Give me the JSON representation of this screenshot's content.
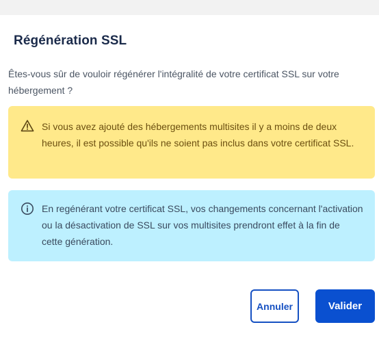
{
  "dialog": {
    "title": "Régénération SSL",
    "question": "Êtes-vous sûr de vouloir régénérer l'intégralité de votre certificat SSL sur votre hébergement ?"
  },
  "alerts": [
    {
      "type": "warning",
      "icon": "warning-triangle-icon",
      "text": "Si vous avez ajouté des hébergements multisites il y a moins de deux heures, il est possible qu'ils ne soient pas inclus dans votre certificat SSL.",
      "background": "#ffe98a",
      "text_color": "#6b4f10"
    },
    {
      "type": "info",
      "icon": "info-circle-icon",
      "text": "En regénérant votre certificat SSL, vos changements concernant l'activation ou la désactivation de SSL sur vos multisites prendront effet à la fin de cette génération.",
      "background": "#bdf0ff",
      "text_color": "#3a4a5e"
    }
  ],
  "actions": {
    "cancel_label": "Annuler",
    "confirm_label": "Valider"
  },
  "colors": {
    "primary": "#0a50d0",
    "title": "#1a2a4a"
  }
}
